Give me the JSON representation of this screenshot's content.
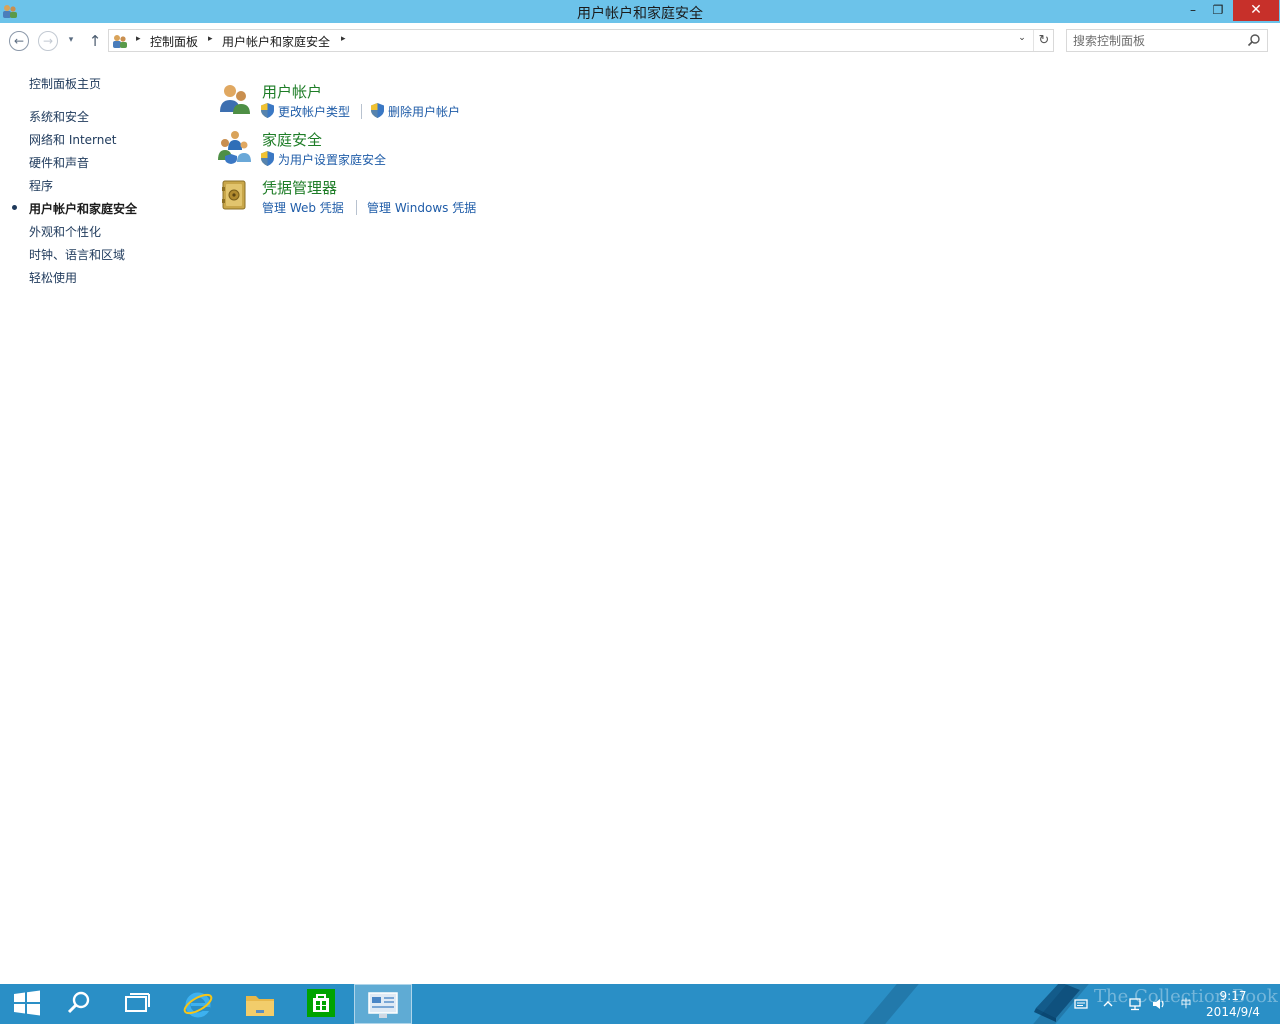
{
  "window": {
    "title": "用户帐户和家庭安全",
    "minimize": "–",
    "restore": "❐",
    "close": "✕"
  },
  "nav": {
    "back": "←",
    "forward": "→",
    "recent": "▾",
    "up": "↑",
    "breadcrumbs": [
      "控制面板",
      "用户帐户和家庭安全"
    ],
    "crumb_separator": "▸",
    "dropdown": "⌄",
    "refresh": "↻"
  },
  "search": {
    "placeholder": "搜索控制面板"
  },
  "sidebar": {
    "home": "控制面板主页",
    "items": [
      {
        "label": "系统和安全"
      },
      {
        "label": "网络和 Internet"
      },
      {
        "label": "硬件和声音"
      },
      {
        "label": "程序"
      },
      {
        "label": "用户帐户和家庭安全",
        "active": true
      },
      {
        "label": "外观和个性化"
      },
      {
        "label": "时钟、语言和区域"
      },
      {
        "label": "轻松使用"
      }
    ]
  },
  "categories": [
    {
      "title": "用户帐户",
      "icon": "users-icon",
      "links": [
        "更改帐户类型",
        "删除用户帐户"
      ]
    },
    {
      "title": "家庭安全",
      "icon": "family-safety-icon",
      "links": [
        "为用户设置家庭安全"
      ]
    },
    {
      "title": "凭据管理器",
      "icon": "credential-vault-icon",
      "links": [
        "管理 Web 凭据",
        "管理 Windows 凭据"
      ]
    }
  ],
  "taskbar": {
    "clock_time": "9:17",
    "clock_date": "2014/9/4",
    "ime": "中",
    "watermark": "The Collection Book"
  },
  "colors": {
    "titlebar": "#6cc3ea",
    "taskbar": "#2a8fc6",
    "category_title": "#1e7d27",
    "link": "#1f5ca8",
    "close_button": "#c7302a"
  }
}
